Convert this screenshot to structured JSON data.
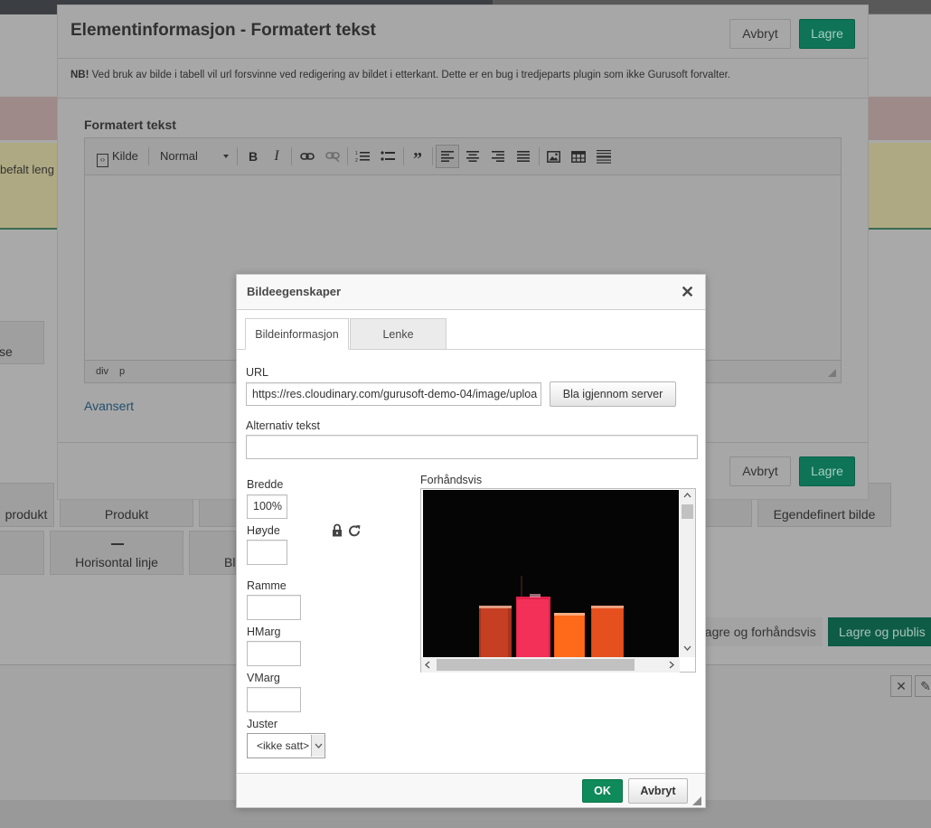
{
  "background": {
    "text_left": "befalt leng",
    "tiles_row1": [
      "se",
      "produkt",
      "Produkt",
      "Egendefinert bilde"
    ],
    "tiles_row2": [
      "Horisontal linje",
      "Bl"
    ],
    "btn_save_preview": "Lagre og forhåndsvis",
    "btn_save_publish": "Lagre og publis",
    "close_glyph": "✕",
    "edit_glyph": "✎"
  },
  "modal": {
    "title": "Elementinformasjon - Formatert tekst",
    "note_bold": "NB!",
    "note_text": " Ved bruk av bilde i tabell vil url forsvinne ved redigering av bildet i etterkant. Dette er en bug i tredjeparts plugin som ikke Gurusoft forvalter.",
    "cancel_label": "Avbryt",
    "save_label": "Lagre",
    "field_label": "Formatert tekst",
    "advanced_link": "Avansert",
    "toolbar": {
      "source_label": "Kilde",
      "format_value": "Normal"
    },
    "status_path": [
      "div",
      "p"
    ]
  },
  "dialog": {
    "title": "Bildeegenskaper",
    "close_glyph": "✕",
    "tabs": [
      {
        "label": "Bildeinformasjon",
        "active": true
      },
      {
        "label": "Lenke",
        "active": false
      }
    ],
    "url_label": "URL",
    "url_value": "https://res.cloudinary.com/gurusoft-demo-04/image/uploa",
    "browse_button": "Bla igjennom server",
    "alt_label": "Alternativ tekst",
    "alt_value": "",
    "width_label": "Bredde",
    "width_value": "100%",
    "height_label": "Høyde",
    "height_value": "",
    "border_label": "Ramme",
    "border_value": "",
    "hspace_label": "HMarg",
    "hspace_value": "",
    "vspace_label": "VMarg",
    "vspace_value": "",
    "align_label": "Juster",
    "align_value": "<ikke satt>",
    "preview_label": "Forhåndsvis",
    "ok_label": "OK",
    "cancel_label": "Avbryt"
  }
}
